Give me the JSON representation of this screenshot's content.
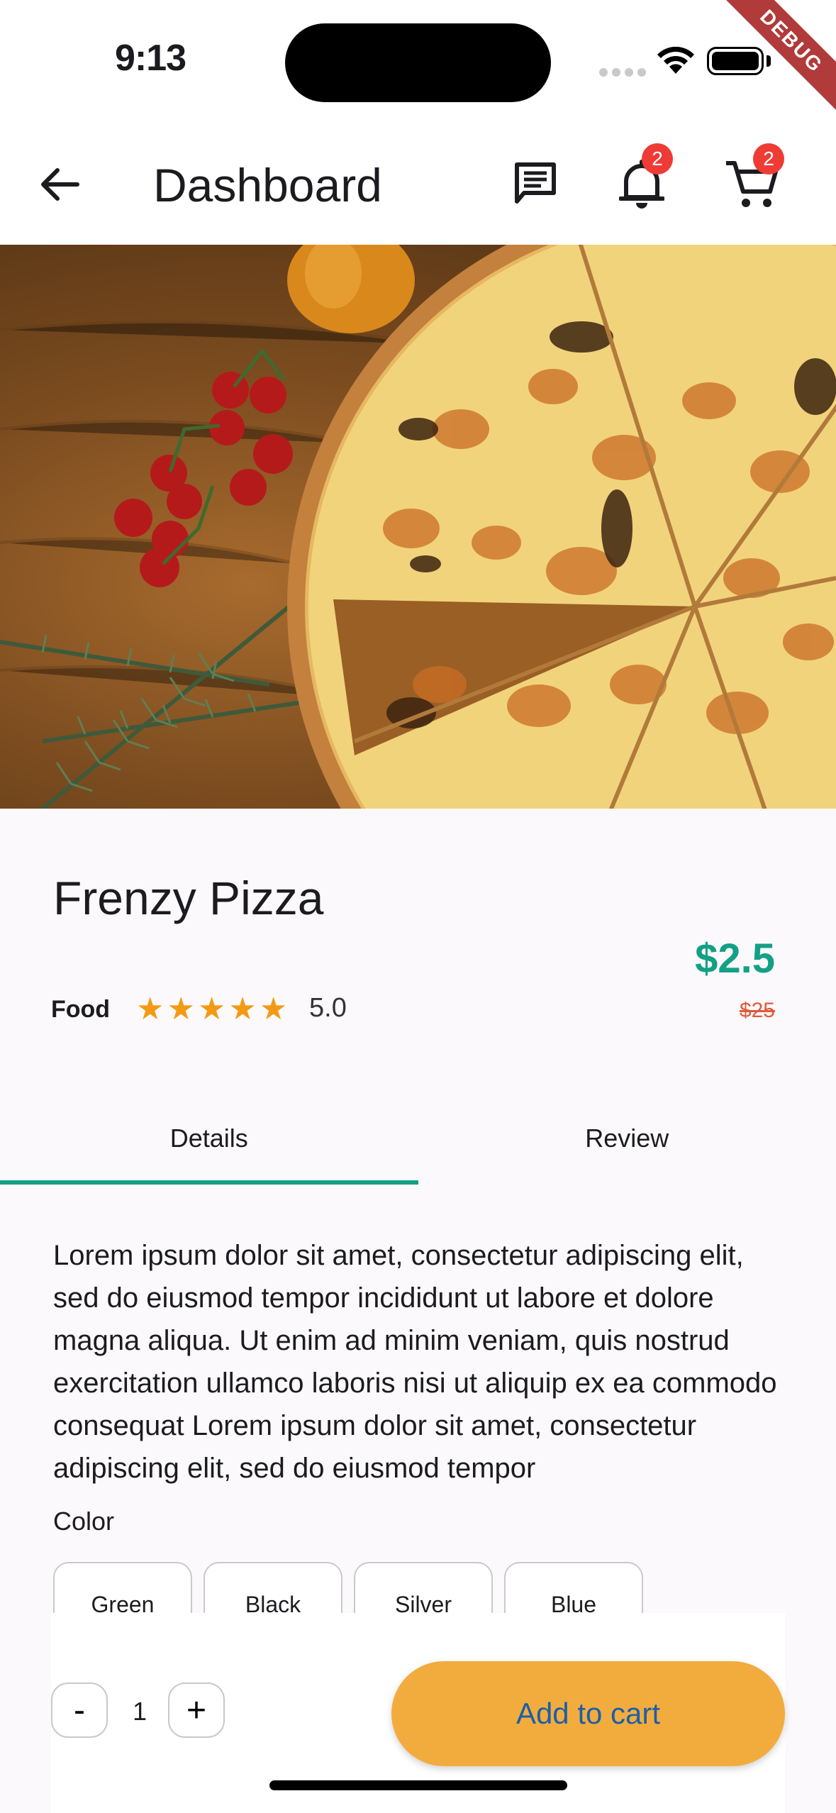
{
  "status_bar": {
    "time": "9:13",
    "debug_label": "DEBUG"
  },
  "app_bar": {
    "title": "Dashboard",
    "notifications_count": "2",
    "cart_count": "2",
    "icons": [
      "back-arrow-icon",
      "chat-icon",
      "bell-icon",
      "cart-icon"
    ]
  },
  "product": {
    "image_alt": "Pizza on wooden board with cherry tomatoes and rosemary",
    "name": "Frenzy Pizza",
    "category": "Food",
    "rating": "5.0",
    "stars": 5,
    "price": "$2.5",
    "old_price": "$25"
  },
  "tabs": [
    {
      "label": "Details",
      "active": true
    },
    {
      "label": "Review",
      "active": false
    }
  ],
  "description": "Lorem ipsum dolor sit amet, consectetur adipiscing elit, sed do eiusmod tempor incididunt ut labore et dolore magna aliqua. Ut enim ad minim veniam, quis nostrud exercitation ullamco laboris nisi ut aliquip ex ea commodo consequat Lorem ipsum dolor sit amet, consectetur adipiscing elit, sed do eiusmod tempor",
  "color_section": {
    "label": "Color",
    "options": [
      "Green",
      "Black",
      "Silver",
      "Blue"
    ]
  },
  "cart_bar": {
    "minus_label": "-",
    "quantity": "1",
    "plus_label": "+",
    "add_label": "Add to cart"
  },
  "colors": {
    "accent_teal": "#14a085",
    "badge_red": "#ef3b36",
    "star_orange": "#f39a14",
    "button_orange": "#f2ac3e",
    "button_text_blue": "#1c5fa8"
  }
}
